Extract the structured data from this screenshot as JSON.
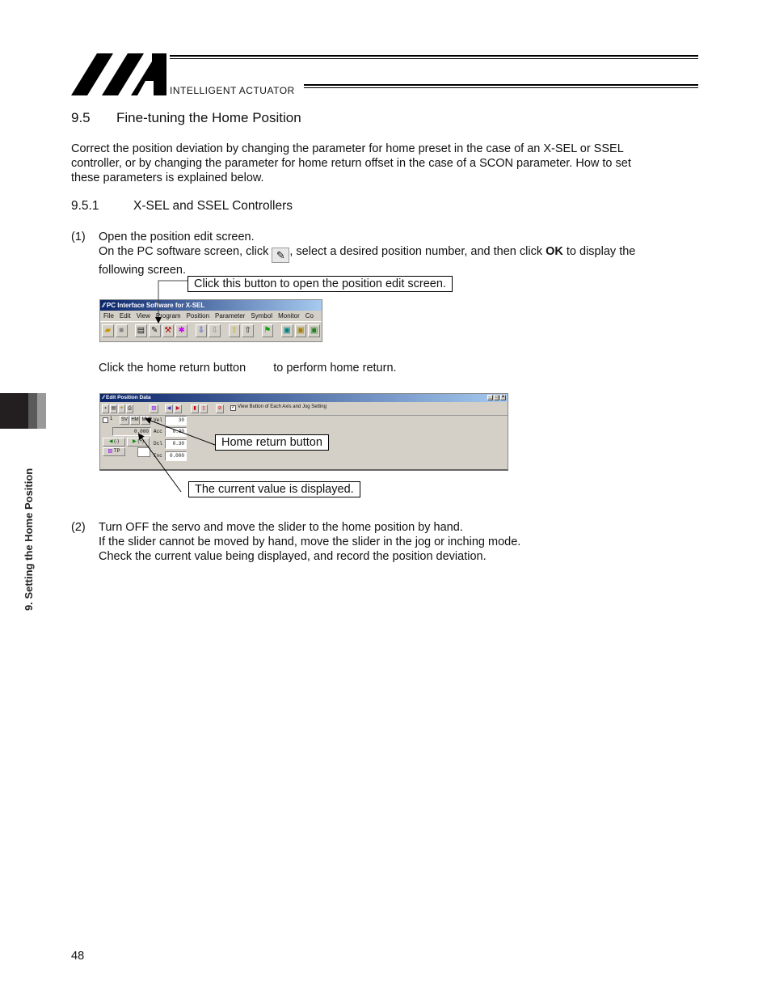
{
  "header": {
    "brand": "INTELLIGENT ACTUATOR"
  },
  "side_tab": {
    "label": "9. Setting the Home Position"
  },
  "section": {
    "number": "9.5",
    "title": "Fine-tuning the Home Position",
    "intro": [
      "Correct the position deviation by changing the parameter for home preset in the case of an X-SEL or SSEL",
      "controller, or by changing the parameter for home return offset in the case of a SCON parameter. How to set",
      "these parameters is explained below."
    ]
  },
  "subsection": {
    "number": "9.5.1",
    "title": "X-SEL and SSEL Controllers"
  },
  "step1": {
    "number": "(1)",
    "line1": "Open the position edit screen.",
    "line2_pre": "On the PC software screen, click ",
    "line2_mid": ", select a desired position number, and then click ",
    "line2_bold": "OK",
    "line2_post": " to display the",
    "line3": "following screen.",
    "callout_edit": "Click this button to open the position edit screen.",
    "home_pre": "Click the home return button",
    "home_post": "to perform home return.",
    "callout_home": "Home return button",
    "callout_current": "The current value is displayed."
  },
  "step2": {
    "number": "(2)",
    "lines": [
      "Turn OFF the servo and move the slider to the home position by hand.",
      "If the slider cannot be moved by hand, move the slider in the jog or inching mode.",
      "Check the current value being displayed, and record the position deviation."
    ]
  },
  "software_window": {
    "title": "PC Interface Software for X-SEL",
    "menu": [
      "File",
      "Edit",
      "View",
      "Program",
      "Position",
      "Parameter",
      "Symbol",
      "Monitor",
      "Co"
    ],
    "toolbar_icons": [
      "open-folder-icon",
      "stop-icon",
      "program-edit-icon",
      "position-edit-icon",
      "tools-icon",
      "symbol-icon",
      "download-icon",
      "upload-icon",
      "arrow-up-filled-icon",
      "arrow-up-icon",
      "flag-icon",
      "cube-1-icon",
      "cube-2-icon",
      "cube-3-icon"
    ]
  },
  "edit_window": {
    "title": "Edit Position Data",
    "checkbox_label": "View Button of Each Axis and Jog Setting",
    "position_number": "1",
    "buttons": {
      "sv": "SV",
      "hm": "HM",
      "mv": "MV",
      "jog_minus": "(-)",
      "jog_plus": "(+)",
      "tp": "TP"
    },
    "current_value": "0.000",
    "fields": [
      {
        "label": "Vel",
        "value": "30"
      },
      {
        "label": "Acc",
        "value": "0.30"
      },
      {
        "label": "Dcl",
        "value": "0.30"
      },
      {
        "label": "Inc",
        "value": "0.000"
      }
    ]
  },
  "footer": {
    "page_number": "48"
  }
}
